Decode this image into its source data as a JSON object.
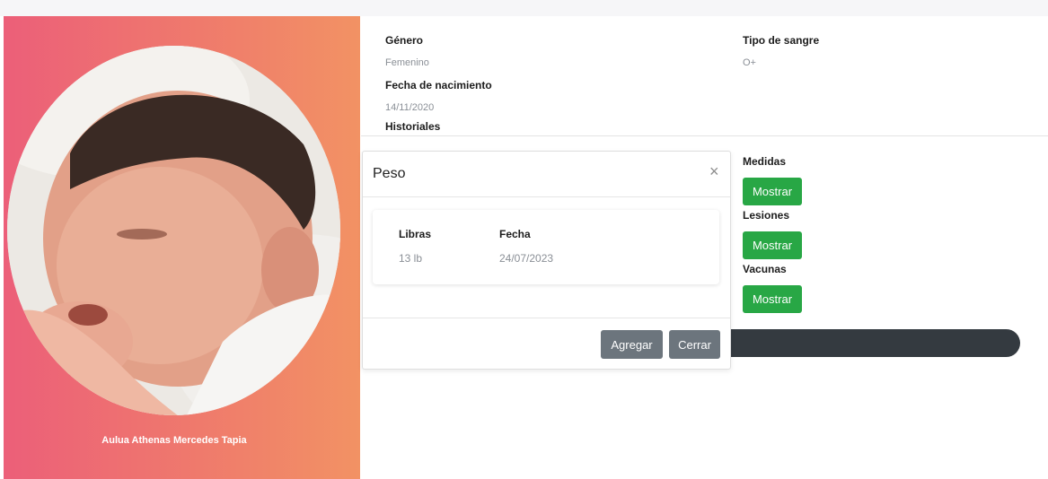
{
  "profile": {
    "name": "Aulua Athenas Mercedes Tapia",
    "photo_alt": "newborn-baby-photo"
  },
  "details": {
    "genero_label": "Género",
    "genero_value": "Femenino",
    "fecha_label": "Fecha de nacimiento",
    "fecha_value": "14/11/2020",
    "tipo_sangre_label": "Tipo de sangre",
    "tipo_sangre_value": "O+",
    "historiales_label": "Historiales"
  },
  "history": {
    "items": [
      {
        "label": "Medidas",
        "button": "Mostrar"
      },
      {
        "label": "Lesiones",
        "button": "Mostrar"
      },
      {
        "label": "Vacunas",
        "button": "Mostrar"
      }
    ]
  },
  "modal": {
    "title": "Peso",
    "close_glyph": "×",
    "columns": [
      "Libras",
      "Fecha"
    ],
    "rows": [
      [
        "13 lb",
        "24/07/2023"
      ]
    ],
    "add_label": "Agregar",
    "close_label": "Cerrar"
  },
  "colors": {
    "accent_green": "#28a745",
    "secondary_gray": "#6c757d",
    "gradient_start": "#ec5f79",
    "gradient_end": "#f29264"
  }
}
